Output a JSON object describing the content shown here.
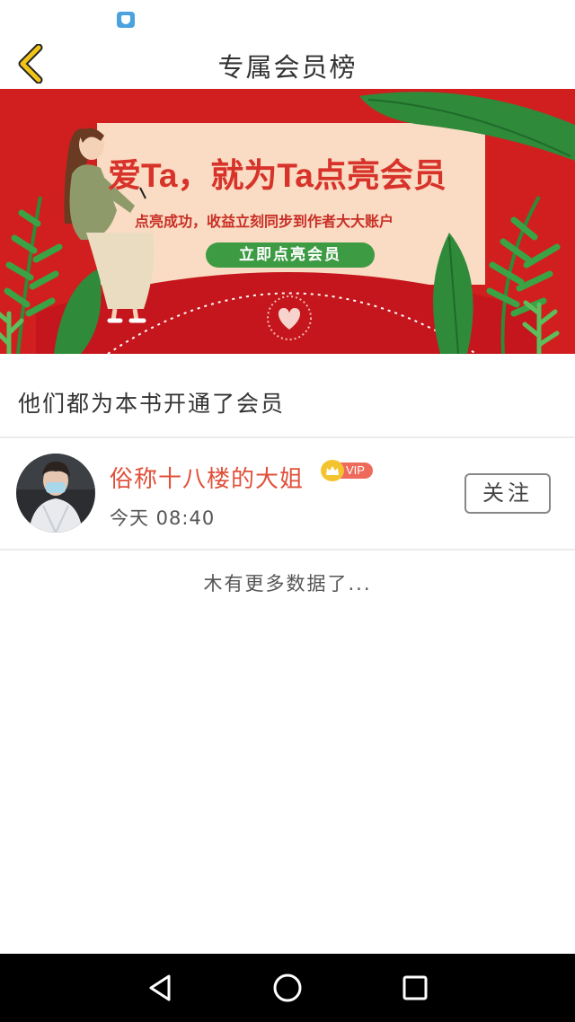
{
  "status_bar": {
    "notification_icon": "shield-app-icon"
  },
  "header": {
    "title": "专属会员榜",
    "back_icon": "chevron-left-icon"
  },
  "banner": {
    "headline": "爱Ta，就为Ta点亮会员",
    "subtitle": "点亮成功，收益立刻同步到作者大大账户",
    "button_label": "立即点亮会员",
    "colors": {
      "background": "#d11f1f",
      "card": "#f9dcc3",
      "button": "#3d9b44",
      "leaf": "#2f8a3a"
    }
  },
  "section": {
    "heading": "他们都为本书开通了会员"
  },
  "members": [
    {
      "name": "俗称十八楼的大姐",
      "badge": "VIP",
      "time": "今天 08:40",
      "follow_label": "关注"
    }
  ],
  "footer": {
    "no_more": "木有更多数据了..."
  },
  "nav_bar": {
    "back_icon": "triangle-back-icon",
    "home_icon": "circle-home-icon",
    "recents_icon": "square-recents-icon"
  },
  "colors": {
    "name": "#e0503a",
    "vip_pill": "#ee6a5a",
    "vip_crown": "#f4c430",
    "back_chevron": "#f0c419"
  }
}
